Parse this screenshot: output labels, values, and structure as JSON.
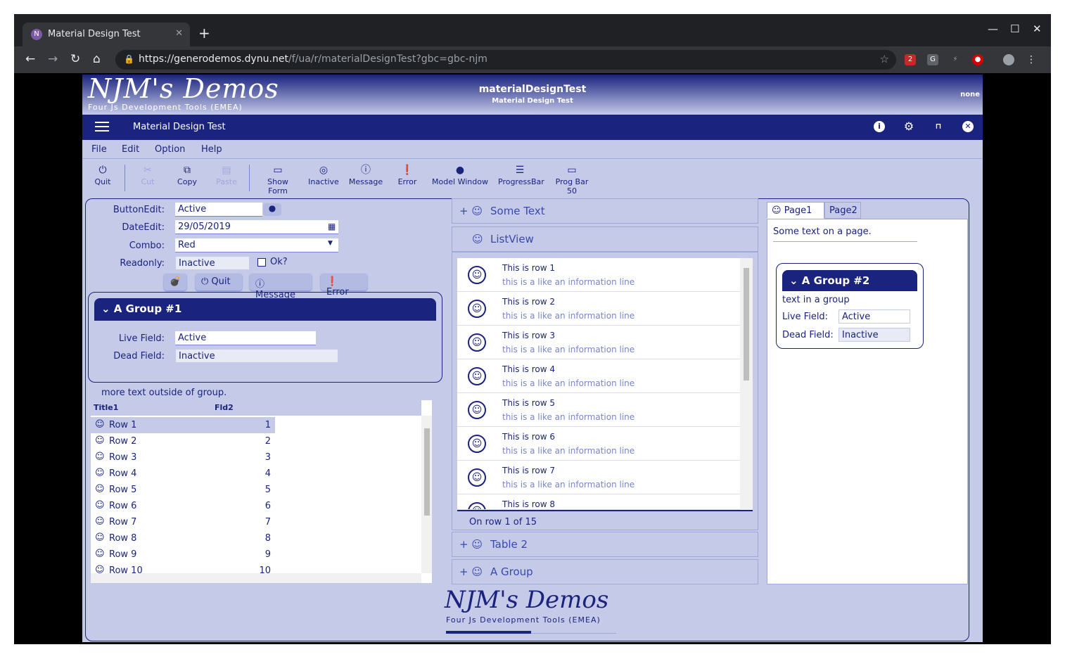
{
  "browser": {
    "tab_title": "Material Design Test",
    "url_host": "https://generodemos.dynu.net",
    "url_path": "/f/ua/r/materialDesignTest?gbc=gbc-njm",
    "ext_badge": "2"
  },
  "header": {
    "logo": "NJM's Demos",
    "logo_sub": "Four Js Development Tools (EMEA)",
    "app_name": "materialDesignTest",
    "app_sub": "Material Design Test",
    "user": "none"
  },
  "topbar": {
    "title": "Material Design Test"
  },
  "menu": [
    "File",
    "Edit",
    "Option",
    "Help"
  ],
  "toolbar": [
    {
      "label": "Quit",
      "icon": "power-icon",
      "enabled": true
    },
    {
      "label": "Cut",
      "icon": "scissors-icon",
      "enabled": false
    },
    {
      "label": "Copy",
      "icon": "copy-icon",
      "enabled": true
    },
    {
      "label": "Paste",
      "icon": "paste-icon",
      "enabled": false
    },
    {
      "label": "Show Form",
      "icon": "monitor-icon",
      "enabled": true
    },
    {
      "label": "Inactive",
      "icon": "eye-off-icon",
      "enabled": true
    },
    {
      "label": "Message",
      "icon": "info-icon",
      "enabled": true
    },
    {
      "label": "Error",
      "icon": "error-icon",
      "enabled": true
    },
    {
      "label": "Model Window",
      "icon": "circle-icon",
      "enabled": true
    },
    {
      "label": "ProgressBar",
      "icon": "sliders-icon",
      "enabled": true
    },
    {
      "label": "Prog Bar 50",
      "icon": "battery-icon",
      "enabled": true
    }
  ],
  "form": {
    "buttonedit_label": "ButtonEdit:",
    "buttonedit_value": "Active",
    "dateedit_label": "DateEdit:",
    "dateedit_value": "29/05/2019",
    "combo_label": "Combo:",
    "combo_value": "Red",
    "readonly_label": "Readonly:",
    "readonly_value": "Inactive",
    "ok_label": "Ok?",
    "btn_quit": "Quit",
    "btn_message": "Message",
    "btn_error": "Error"
  },
  "group1": {
    "title": "A Group #1",
    "live_label": "Live Field:",
    "live_value": "Active",
    "dead_label": "Dead Field:",
    "dead_value": "Inactive"
  },
  "outside_text": "more text outside of group.",
  "table": {
    "columns": [
      "Title1",
      "Fld2"
    ],
    "rows": [
      {
        "title": "Row 1",
        "fld": "1"
      },
      {
        "title": "Row 2",
        "fld": "2"
      },
      {
        "title": "Row 3",
        "fld": "3"
      },
      {
        "title": "Row 4",
        "fld": "4"
      },
      {
        "title": "Row 5",
        "fld": "5"
      },
      {
        "title": "Row 6",
        "fld": "6"
      },
      {
        "title": "Row 7",
        "fld": "7"
      },
      {
        "title": "Row 8",
        "fld": "8"
      },
      {
        "title": "Row 9",
        "fld": "9"
      },
      {
        "title": "Row 10",
        "fld": "10"
      }
    ]
  },
  "panels": {
    "some_text": "Some Text",
    "listview": "ListView",
    "table2": "Table 2",
    "a_group": "A Group"
  },
  "listview": {
    "rows": [
      {
        "title": "This is row 1",
        "info": "this is a like an information line"
      },
      {
        "title": "This is row 2",
        "info": "this is a like an information line"
      },
      {
        "title": "This is row 3",
        "info": "this is a like an information line"
      },
      {
        "title": "This is row 4",
        "info": "this is a like an information line"
      },
      {
        "title": "This is row 5",
        "info": "this is a like an information line"
      },
      {
        "title": "This is row 6",
        "info": "this is a like an information line"
      },
      {
        "title": "This is row 7",
        "info": "this is a like an information line"
      },
      {
        "title": "This is row 8",
        "info": ""
      }
    ],
    "status": "On row 1 of 15"
  },
  "pages": {
    "tab1": "Page1",
    "tab2": "Page2",
    "text": "Some text on a page.",
    "group2_title": "A Group #2",
    "group2_text": "text in a group",
    "live_label": "Live Field:",
    "live_value": "Active",
    "dead_label": "Dead Field:",
    "dead_value": "Inactive"
  },
  "footer": {
    "logo": "NJM's Demos",
    "logo_sub": "Four Js Development Tools (EMEA)",
    "progress_fraction": 0.5
  }
}
